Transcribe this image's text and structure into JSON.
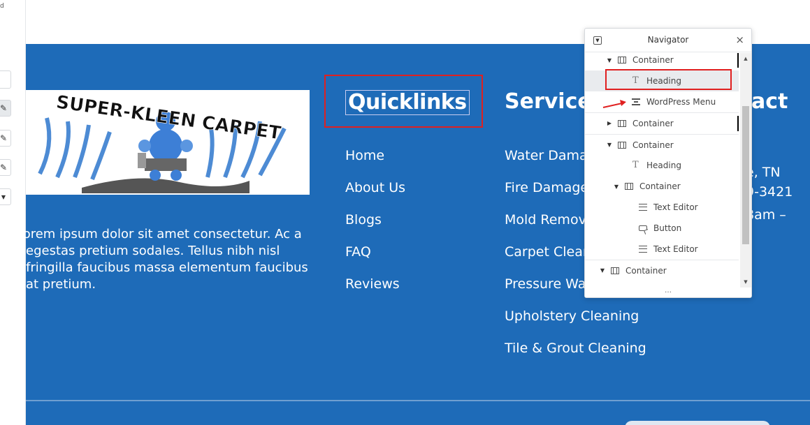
{
  "left_panel": {
    "partial_text": "d"
  },
  "logo": {
    "text": "SUPER-KLEEN CARPET"
  },
  "about": {
    "text": "Lorem ipsum dolor sit amet consectetur. Ac a egestas pretium sodales. Tellus nibh nisl fringilla faucibus massa elementum faucibus at pretium."
  },
  "quicklinks": {
    "heading": "Quicklinks",
    "items": [
      "Home",
      "About Us",
      "Blogs",
      "FAQ",
      "Reviews"
    ]
  },
  "services": {
    "heading": "Service",
    "items": [
      "Water Dama",
      "Fire Damage",
      "Mold Remov",
      "Carpet Clean",
      "Pressure Wa",
      "Upholstery Cleaning",
      "Tile & Grout Cleaning"
    ]
  },
  "contact": {
    "heading": "act",
    "lines": [
      "e, TN",
      "9-3421",
      "8am –"
    ]
  },
  "navigator": {
    "title": "Navigator",
    "close": "×",
    "more": "…",
    "items": [
      {
        "label": "Container",
        "icon": "container-icon",
        "arrow": "down"
      },
      {
        "label": "Heading",
        "icon": "heading-icon",
        "arrow": "",
        "selected": true
      },
      {
        "label": "WordPress Menu",
        "icon": "menu-icon",
        "arrow": ""
      },
      {
        "label": "Container",
        "icon": "container-icon",
        "arrow": "right"
      },
      {
        "label": "Container",
        "icon": "container-icon",
        "arrow": "down"
      },
      {
        "label": "Heading",
        "icon": "heading-icon",
        "arrow": ""
      },
      {
        "label": "Container",
        "icon": "container-icon",
        "arrow": "down"
      },
      {
        "label": "Text Editor",
        "icon": "text-editor-icon",
        "arrow": ""
      },
      {
        "label": "Button",
        "icon": "button-icon",
        "arrow": ""
      },
      {
        "label": "Text Editor",
        "icon": "text-editor-icon",
        "arrow": ""
      },
      {
        "label": "Container",
        "icon": "container-icon",
        "arrow": "down"
      }
    ]
  },
  "colors": {
    "footer_bg": "#1e6bb8",
    "highlight_red": "#e02020",
    "text_white": "#ffffff"
  }
}
